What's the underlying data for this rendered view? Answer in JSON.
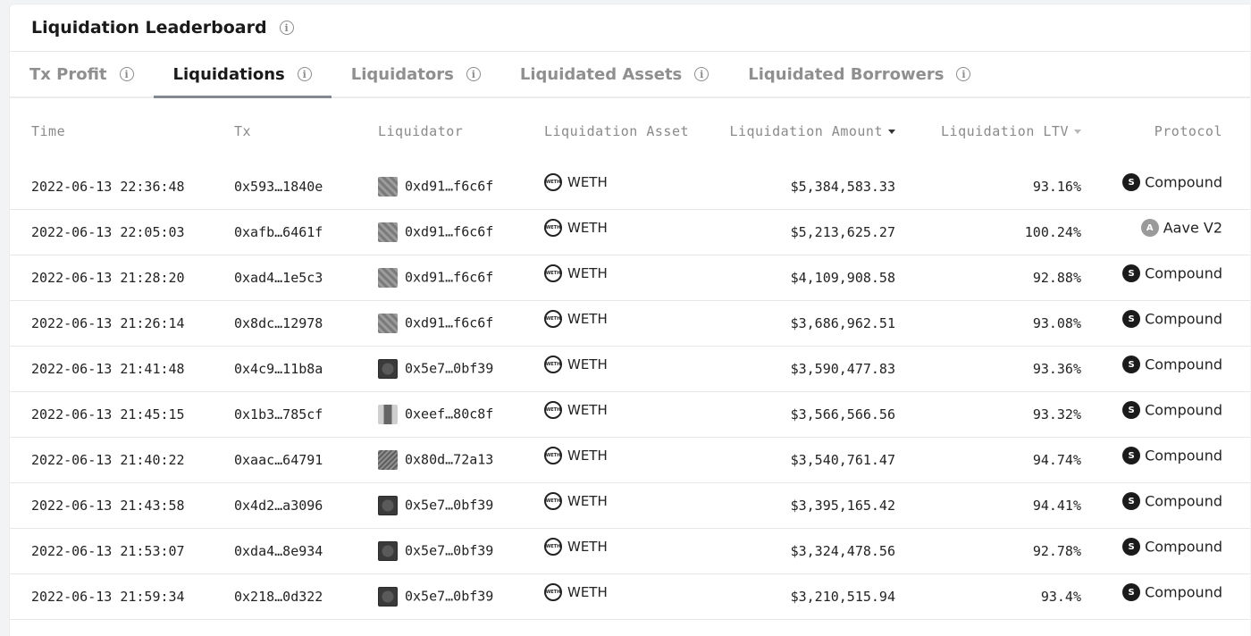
{
  "header": {
    "title": "Liquidation Leaderboard"
  },
  "tabs": [
    {
      "label": "Tx Profit",
      "active": false
    },
    {
      "label": "Liquidations",
      "active": true
    },
    {
      "label": "Liquidators",
      "active": false
    },
    {
      "label": "Liquidated Assets",
      "active": false
    },
    {
      "label": "Liquidated Borrowers",
      "active": false
    }
  ],
  "columns": {
    "time": "Time",
    "tx": "Tx",
    "liquidator": "Liquidator",
    "asset": "Liquidation Asset",
    "amount": "Liquidation Amount",
    "ltv": "Liquidation LTV",
    "protocol": "Protocol"
  },
  "rows": [
    {
      "time": "2022-06-13 22:36:48",
      "tx": "0x593…1840e",
      "liquidator": "0xd91…f6c6f",
      "asset": "WETH",
      "amount": "$5,384,583.33",
      "ltv": "93.16%",
      "protocol": "Compound"
    },
    {
      "time": "2022-06-13 22:05:03",
      "tx": "0xafb…6461f",
      "liquidator": "0xd91…f6c6f",
      "asset": "WETH",
      "amount": "$5,213,625.27",
      "ltv": "100.24%",
      "protocol": "Aave V2"
    },
    {
      "time": "2022-06-13 21:28:20",
      "tx": "0xad4…1e5c3",
      "liquidator": "0xd91…f6c6f",
      "asset": "WETH",
      "amount": "$4,109,908.58",
      "ltv": "92.88%",
      "protocol": "Compound"
    },
    {
      "time": "2022-06-13 21:26:14",
      "tx": "0x8dc…12978",
      "liquidator": "0xd91…f6c6f",
      "asset": "WETH",
      "amount": "$3,686,962.51",
      "ltv": "93.08%",
      "protocol": "Compound"
    },
    {
      "time": "2022-06-13 21:41:48",
      "tx": "0x4c9…11b8a",
      "liquidator": "0x5e7…0bf39",
      "asset": "WETH",
      "amount": "$3,590,477.83",
      "ltv": "93.36%",
      "protocol": "Compound"
    },
    {
      "time": "2022-06-13 21:45:15",
      "tx": "0x1b3…785cf",
      "liquidator": "0xeef…80c8f",
      "asset": "WETH",
      "amount": "$3,566,566.56",
      "ltv": "93.32%",
      "protocol": "Compound"
    },
    {
      "time": "2022-06-13 21:40:22",
      "tx": "0xaac…64791",
      "liquidator": "0x80d…72a13",
      "asset": "WETH",
      "amount": "$3,540,761.47",
      "ltv": "94.74%",
      "protocol": "Compound"
    },
    {
      "time": "2022-06-13 21:43:58",
      "tx": "0x4d2…a3096",
      "liquidator": "0x5e7…0bf39",
      "asset": "WETH",
      "amount": "$3,395,165.42",
      "ltv": "94.41%",
      "protocol": "Compound"
    },
    {
      "time": "2022-06-13 21:53:07",
      "tx": "0xda4…8e934",
      "liquidator": "0x5e7…0bf39",
      "asset": "WETH",
      "amount": "$3,324,478.56",
      "ltv": "92.78%",
      "protocol": "Compound"
    },
    {
      "time": "2022-06-13 21:59:34",
      "tx": "0x218…0d322",
      "liquidator": "0x5e7…0bf39",
      "asset": "WETH",
      "amount": "$3,210,515.94",
      "ltv": "93.4%",
      "protocol": "Compound"
    }
  ]
}
